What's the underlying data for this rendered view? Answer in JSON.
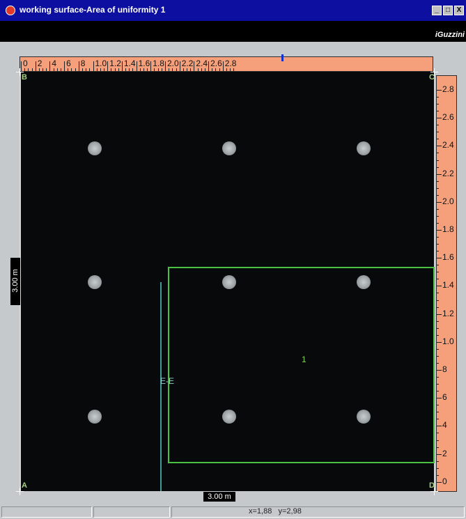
{
  "window": {
    "title": "working surface-Area of uniformity 1",
    "minimize_label": "_",
    "maximize_label": "□",
    "close_label": "X"
  },
  "brand": {
    "text": "iGuzzini"
  },
  "ruler_top": {
    "ticks": [
      "0",
      "2",
      "4",
      "6",
      "8",
      "1.0",
      "1.2",
      "1.4",
      "1.6",
      "1.8",
      "2.0",
      "2.2",
      "2.4",
      "2.6",
      "2.8"
    ]
  },
  "ruler_right": {
    "ticks": [
      "2.8",
      "2.6",
      "2.4",
      "2.2",
      "2.0",
      "1.8",
      "1.6",
      "1.4",
      "1.2",
      "1.0",
      "8",
      "6",
      "4",
      "2",
      "0"
    ]
  },
  "corners": {
    "top_left": "B",
    "top_right": "C",
    "bottom_left": "A",
    "bottom_right": "D"
  },
  "area": {
    "label": "1"
  },
  "section": {
    "label": "E-E"
  },
  "dimensions": {
    "height": "3.00 m",
    "width": "3.00 m"
  },
  "status": {
    "coordinates": "x=1,88   y=2,98"
  },
  "colors": {
    "plan_background": "#07090a",
    "area_outline": "#49c241",
    "ruler": "#f5a07a",
    "titlebar": "#0d0fa0"
  }
}
